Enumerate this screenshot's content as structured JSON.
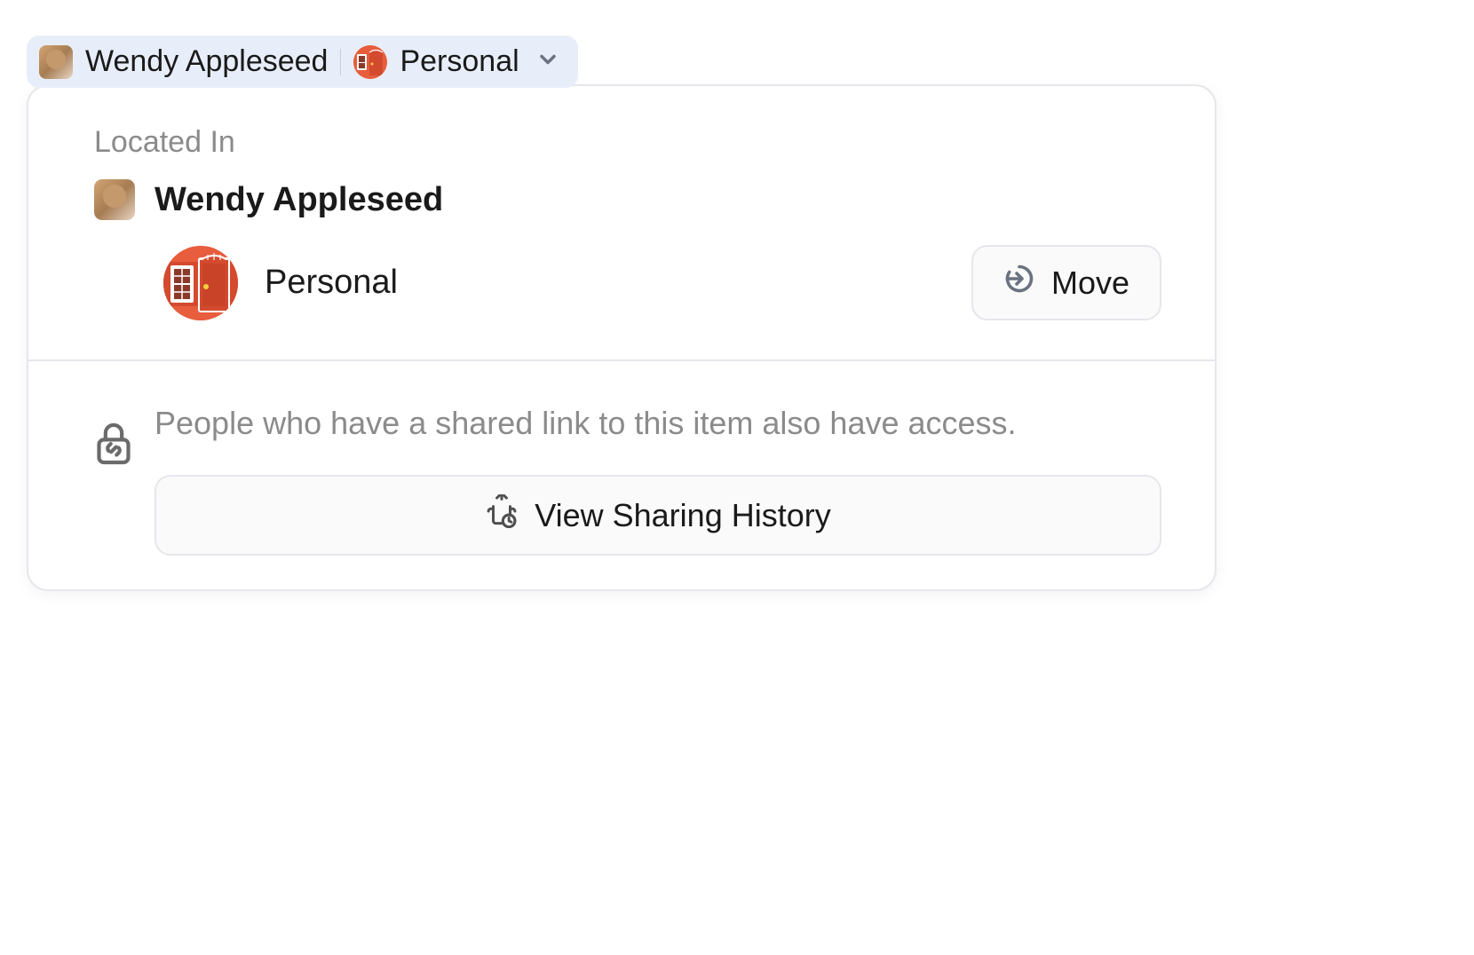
{
  "breadcrumb": {
    "user_name": "Wendy Appleseed",
    "vault_name": "Personal"
  },
  "panel": {
    "section_label": "Located In",
    "owner_name": "Wendy Appleseed",
    "vault_name": "Personal",
    "move_button_label": "Move",
    "sharing_message": "People who have a shared link to this item also have access.",
    "history_button_label": "View Sharing History"
  }
}
